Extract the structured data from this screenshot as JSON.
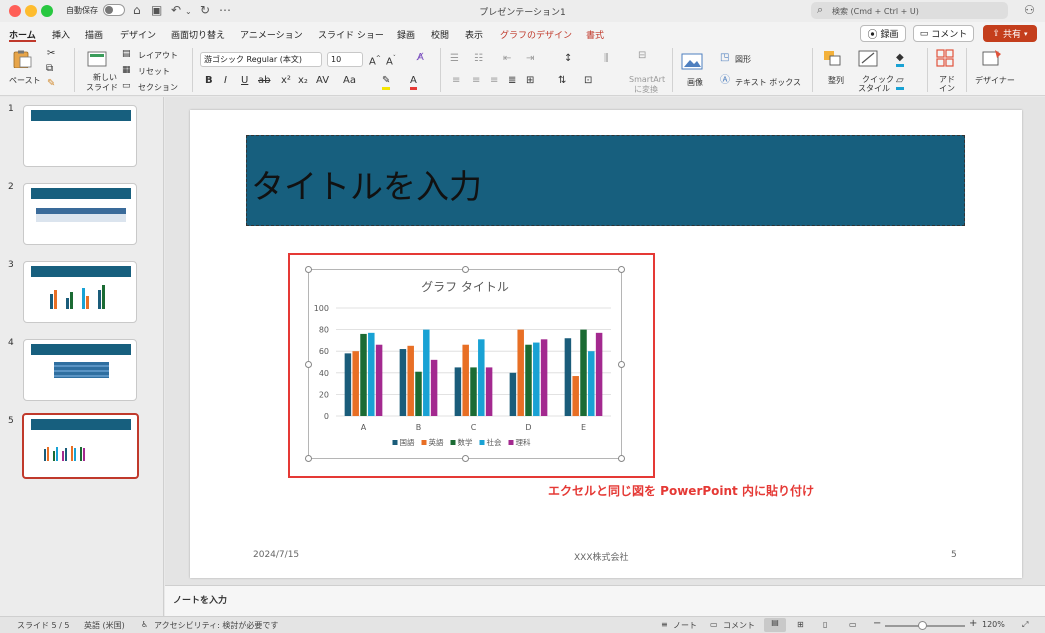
{
  "window": {
    "title": "プレゼンテーション1",
    "autosave_label": "自動保存",
    "search_placeholder": "検索 (Cmd + Ctrl + U)",
    "traffic_colors": [
      "#ff5f57",
      "#febc2e",
      "#28c840"
    ]
  },
  "tabs": [
    {
      "label": "ホーム",
      "active": true
    },
    {
      "label": "挿入"
    },
    {
      "label": "描画"
    },
    {
      "label": "デザイン"
    },
    {
      "label": "画面切り替え"
    },
    {
      "label": "アニメーション"
    },
    {
      "label": "スライド ショー"
    },
    {
      "label": "録画"
    },
    {
      "label": "校閲"
    },
    {
      "label": "表示"
    },
    {
      "label": "グラフのデザイン",
      "contextual": true
    },
    {
      "label": "書式",
      "contextual": true
    }
  ],
  "header_buttons": {
    "record": "録画",
    "comment": "コメント",
    "share": "共有"
  },
  "ribbon": {
    "paste": "ペースト",
    "new_slide_line1": "新しい",
    "new_slide_line2": "スライド",
    "layout": "レイアウト",
    "reset": "リセット",
    "section": "セクション",
    "font_name": "游ゴシック Regular (本文)",
    "font_size": "10",
    "smartart_line1": "SmartArt",
    "smartart_line2": "に変換",
    "image": "画像",
    "shapes": "図形",
    "textbox": "テキスト ボックス",
    "arrange": "整列",
    "quick_style_line1": "クイック",
    "quick_style_line2": "スタイル",
    "addin_line1": "アド",
    "addin_line2": "イン",
    "designer": "デザイナー",
    "accent_color": "#c0392b"
  },
  "slides": {
    "numbers": [
      "1",
      "2",
      "3",
      "4",
      "5"
    ],
    "selected": 5,
    "accent": "#175f7e"
  },
  "slide": {
    "title": "タイトルを入力",
    "callout": "エクセルと同じ図を PowerPoint 内に貼り付け",
    "date": "2024/7/15",
    "company": "XXX株式会社",
    "page": "5",
    "title_bg": "#175f7e"
  },
  "chart_data": {
    "type": "bar",
    "title": "グラフ タイトル",
    "categories": [
      "A",
      "B",
      "C",
      "D",
      "E"
    ],
    "ylim": [
      0,
      100
    ],
    "yticks": [
      "0",
      "20",
      "40",
      "60",
      "80",
      "100"
    ],
    "grid": true,
    "legend_position": "bottom",
    "series": [
      {
        "name": "国語",
        "color": "#1a5c7a",
        "values": [
          58,
          62,
          45,
          40,
          72
        ]
      },
      {
        "name": "英語",
        "color": "#e86f25",
        "values": [
          60,
          65,
          66,
          80,
          37
        ]
      },
      {
        "name": "数学",
        "color": "#1b6b33",
        "values": [
          76,
          41,
          45,
          66,
          80
        ]
      },
      {
        "name": "社会",
        "color": "#19a2d4",
        "values": [
          77,
          80,
          71,
          68,
          60
        ]
      },
      {
        "name": "理科",
        "color": "#a3298f",
        "values": [
          66,
          52,
          45,
          71,
          77
        ]
      }
    ]
  },
  "notes": {
    "placeholder": "ノートを入力"
  },
  "status": {
    "slide_counter": "スライド 5 / 5",
    "language": "英語 (米国)",
    "accessibility": "アクセシビリティ: 検討が必要です",
    "notes": "ノート",
    "comments": "コメント",
    "zoom": "120%"
  }
}
